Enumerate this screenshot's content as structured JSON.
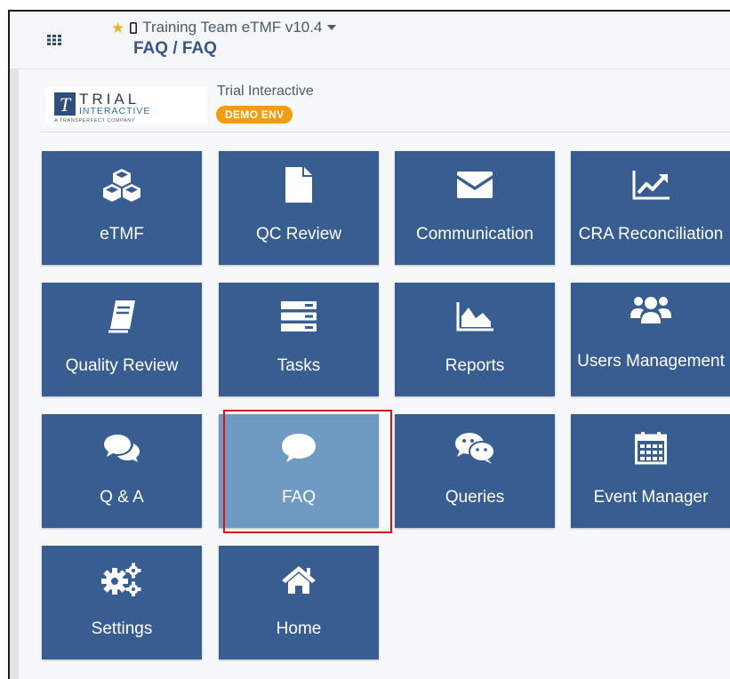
{
  "header": {
    "title": "Training Team eTMF v10.4",
    "breadcrumb": "FAQ / FAQ",
    "icons": [
      "apps-grid-icon",
      "star-icon",
      "mobile-icon",
      "caret-down-icon"
    ]
  },
  "brand": {
    "logo_text": "TRIAL",
    "logo_subtext": "INTERACTIVE",
    "logo_tagline": "A TRANSPERFECT COMPANY",
    "name": "Trial Interactive",
    "env_badge": "DEMO ENV"
  },
  "tiles": [
    {
      "label": "eTMF",
      "icon": "cubes-icon"
    },
    {
      "label": "QC Review",
      "icon": "file-icon"
    },
    {
      "label": "Communication",
      "icon": "envelope-icon"
    },
    {
      "label": "CRA Reconciliation",
      "icon": "line-chart-icon"
    },
    {
      "label": "Quality Review",
      "icon": "book-icon"
    },
    {
      "label": "Tasks",
      "icon": "tasks-icon"
    },
    {
      "label": "Reports",
      "icon": "area-chart-icon"
    },
    {
      "label": "Users Management",
      "icon": "users-icon"
    },
    {
      "label": "Q & A",
      "icon": "comments-icon"
    },
    {
      "label": "FAQ",
      "icon": "comment-icon",
      "active": true
    },
    {
      "label": "Queries",
      "icon": "chat-bubbles-icon"
    },
    {
      "label": "Event Manager",
      "icon": "calendar-icon"
    },
    {
      "label": "Settings",
      "icon": "cogs-icon"
    },
    {
      "label": "Home",
      "icon": "home-icon"
    }
  ],
  "colors": {
    "tile": "#385d91",
    "tile_active": "#6f9ac1",
    "badge": "#f39c12",
    "highlight": "#dd1111",
    "breadcrumb": "#3a5684"
  }
}
